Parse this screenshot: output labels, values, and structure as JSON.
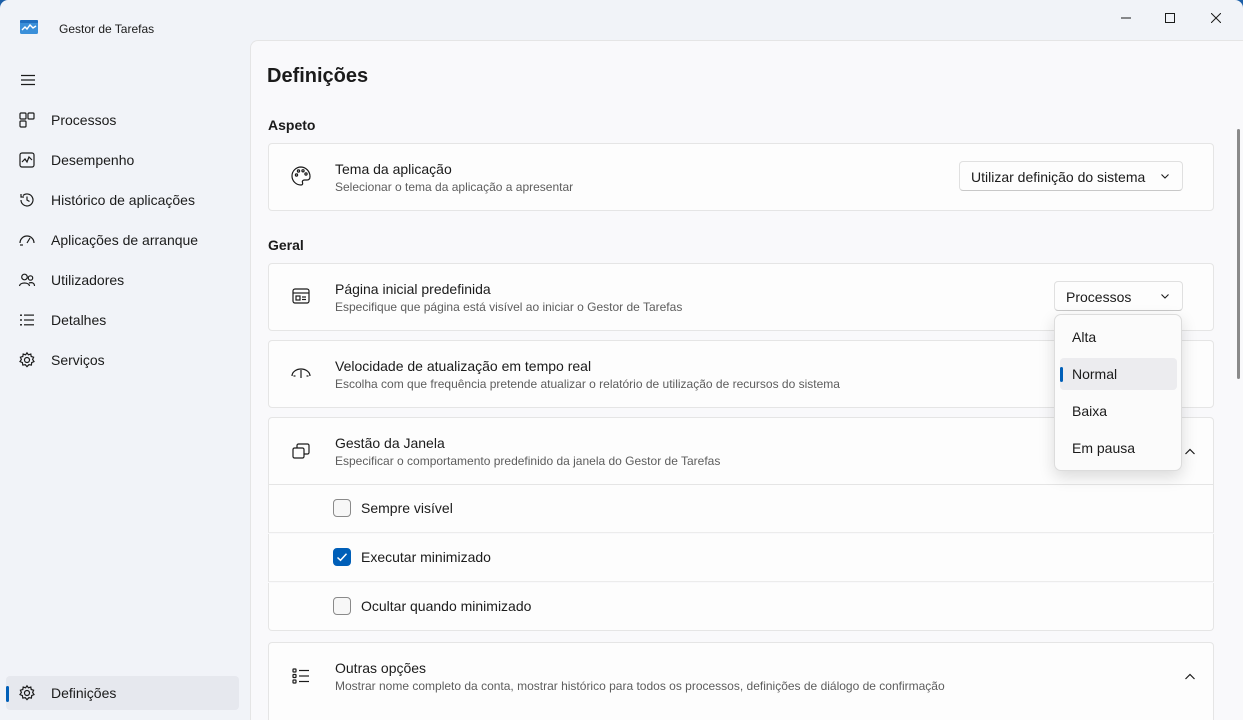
{
  "window": {
    "title": "Gestor de Tarefas"
  },
  "sidebar": {
    "items": [
      {
        "label": "Processos",
        "icon": "processes-icon"
      },
      {
        "label": "Desempenho",
        "icon": "performance-icon"
      },
      {
        "label": "Histórico de aplicações",
        "icon": "app-history-icon"
      },
      {
        "label": "Aplicações de arranque",
        "icon": "startup-apps-icon"
      },
      {
        "label": "Utilizadores",
        "icon": "users-icon"
      },
      {
        "label": "Detalhes",
        "icon": "details-icon"
      },
      {
        "label": "Serviços",
        "icon": "services-icon"
      }
    ],
    "settings_label": "Definições"
  },
  "main": {
    "page_title": "Definições",
    "sections": {
      "appearance": "Aspeto",
      "general": "Geral"
    },
    "theme": {
      "title": "Tema da aplicação",
      "subtitle": "Selecionar o tema da aplicação a apresentar",
      "value": "Utilizar definição do sistema"
    },
    "default_page": {
      "title": "Página inicial predefinida",
      "subtitle": "Especifique que página está visível ao iniciar o Gestor de Tarefas",
      "value": "Processos"
    },
    "update_speed": {
      "title": "Velocidade de atualização em tempo real",
      "subtitle": "Escolha com que frequência pretende atualizar o relatório de utilização de recursos do sistema",
      "options": [
        "Alta",
        "Normal",
        "Baixa",
        "Em pausa"
      ],
      "selected": "Normal"
    },
    "window_management": {
      "title": "Gestão da Janela",
      "subtitle": "Especificar o comportamento predefinido da janela do Gestor de Tarefas",
      "options": [
        {
          "label": "Sempre visível",
          "checked": false
        },
        {
          "label": "Executar minimizado",
          "checked": true
        },
        {
          "label": "Ocultar quando minimizado",
          "checked": false
        }
      ]
    },
    "other_options": {
      "title": "Outras opções",
      "subtitle": "Mostrar nome completo da conta, mostrar histórico para todos os processos, definições de diálogo de confirmação"
    }
  },
  "colors": {
    "accent": "#005fb8",
    "background": "#f1f3f8",
    "card": "#fdfdfd"
  }
}
